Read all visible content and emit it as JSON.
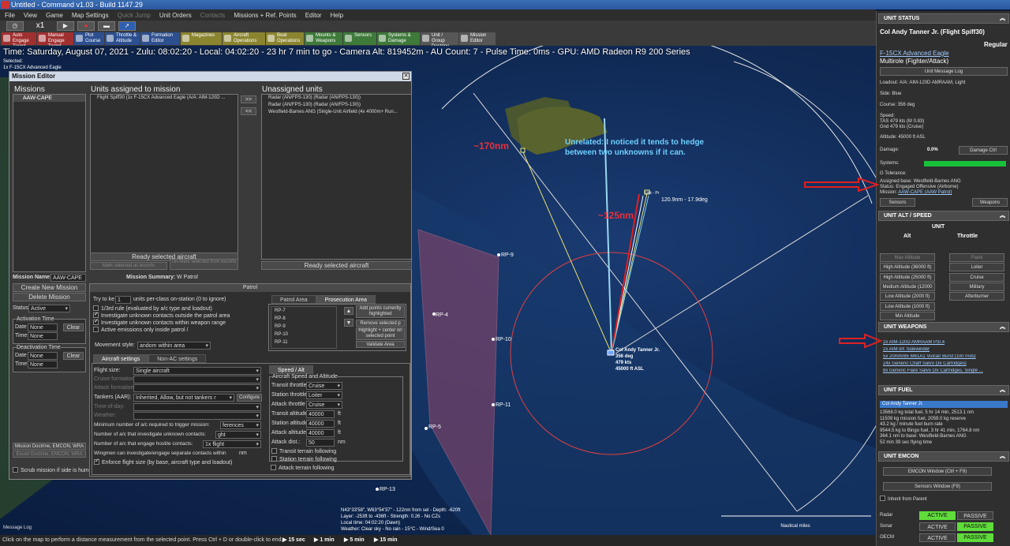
{
  "titlebar": {
    "title": "Untitled - Command v1.03 - Build 1147.29"
  },
  "menu": [
    "File",
    "View",
    "Game",
    "Map Settings",
    "Quick Jump",
    "Unit Orders",
    "Contacts",
    "Missions + Ref. Points",
    "Editor",
    "Help"
  ],
  "menu_disabled": [
    "Quick Jump",
    "Contacts"
  ],
  "toolbar": {
    "speed": "x1",
    "buttons": [
      {
        "label": "Auto Engage Target",
        "color": "red"
      },
      {
        "label": "Manual Engage Target",
        "color": "red"
      },
      {
        "label": "Plot Course",
        "color": "blue"
      },
      {
        "label": "Throttle & Altitude",
        "color": "blue"
      },
      {
        "label": "Formation Editor",
        "color": "blue"
      },
      {
        "label": "Magazines",
        "color": "yellow"
      },
      {
        "label": "Aircraft Operations",
        "color": "yellow"
      },
      {
        "label": "Boat Operations",
        "color": "yellow"
      },
      {
        "label": "Mounts & Weapons",
        "color": "green"
      },
      {
        "label": "Sensors",
        "color": "green"
      },
      {
        "label": "Systems & Damage",
        "color": "green"
      },
      {
        "label": "Unit / Group Doctrine",
        "color": "grey"
      },
      {
        "label": "Mission Editor",
        "color": "grey"
      }
    ]
  },
  "infoline": "Time: Saturday, August 07, 2021 - Zulu: 08:02:20 - Local: 04:02:20 - 23 hr 7 min to go -  Camera Alt: 819452m  - AU Count: 7 - Pulse Time: 0ms - GPU: AMD Radeon R9 200 Series",
  "selected": {
    "line1": "Selected:",
    "line2": "1x F-15CX Advanced Eagle"
  },
  "map": {
    "labels": {
      "rp4": "RP-4",
      "rp5": "RP-5",
      "rp9": "RP-9",
      "rp10": "RP-10",
      "rp11": "RP-11",
      "rp13": "RP-13",
      "bearing": "120.9nm - 17.9deg",
      "contact": "Unk - Pr"
    },
    "annotations": {
      "nm170": "~170nm",
      "nm125": "~125nm",
      "note": "Unrelated: I noticed it tends to hedge between two unknowns if it can."
    },
    "unit_label": {
      "name": "Col Andy Tanner Jr.",
      "heading": "356 deg",
      "speed": "479 kts",
      "alt": "45000 ft ASL"
    },
    "cursor": {
      "line1": "N43°33'58\", W63°54'37\" - 122nm from sel - Depth: -620ft",
      "line2": "Layer: -253ft to -436ft - Strength: 0.26 - No CZs",
      "line3": "Local time: 04:02:20 (Dawn)",
      "line4": "Weather: Clear sky - No rain - 15°C - Wind/Sea 0"
    },
    "scale_label": "Nautical miles"
  },
  "statusbar": {
    "hint": "Click on the map to perform a distance measurement from the selected point. Press Ctrl + D or double-click to end.",
    "steps": [
      "15 sec",
      "1 min",
      "5 min",
      "15 min"
    ],
    "msglog": "Message Log"
  },
  "mission_editor": {
    "title": "Mission Editor",
    "missions_header": "Missions",
    "missions": [
      "AAW-CAPE"
    ],
    "assigned_header": "Units assigned to mission",
    "assigned": [
      "Flight Spiff30 (1x F-15CX Advanced Eagle (A/A: AIM-120D ..."
    ],
    "unassigned_header": "Unassigned units",
    "unassigned": [
      "Radar (AN/FPS-130) (Radar (AN/FPS-130))",
      "Radar (AN/FPS-130) (Radar (AN/FPS-130))",
      "Westfield-Barnes ANG (Single-Unit Airfield (4x 4000m+ Run..."
    ],
    "move_right": ">>",
    "move_left": "<<",
    "ready_assigned": "Ready selected aircraft",
    "mark_escorts": "Mark selected as escorts",
    "unmark_escorts": "Un-Mark selected from escorts",
    "ready_unassigned": "Ready selected aircraft",
    "mission_name_label": "Mission Name:",
    "mission_name": "AAW-CAPE",
    "create_mission": "Create New Mission",
    "delete_mission": "Delete Mission",
    "status_label": "Status:",
    "status_value": "Active",
    "activation_label": "Activation Time",
    "deactivation_label": "Deactivation Time",
    "date_label": "Date",
    "time_label": "Time",
    "none": "None",
    "clear": "Clear",
    "msn_doctrine": "Mission Doctrine, EMCON, WRA",
    "escort_doctrine": "Escort Doctrine, EMCON, WRA",
    "scrub_label": "Scrub mission if side is human",
    "summary_label": "Mission Summary:",
    "summary_value": "W Patrol",
    "patrol_header": "Patrol",
    "try_keep_pre": "Try to ke",
    "try_keep_value": "1",
    "try_keep_post": "units per-class on-station (0 to ignore)",
    "checks": [
      {
        "label": "1/3rd rule (evaluated by a/c type and loadout)",
        "on": false
      },
      {
        "label": "Investigate unknown contacts outside the patrol area",
        "on": true
      },
      {
        "label": "Investigate unknown contacts within weapon range",
        "on": true
      },
      {
        "label": "Active emissions only inside patrol /",
        "on": false
      }
    ],
    "movement_label": "Movement style:",
    "movement_value": "andom within area",
    "area_tabs": [
      "Patrol Area",
      "Prosecution Area"
    ],
    "rp_list": [
      "RP-7",
      "RP-8",
      "RP-9",
      "RP-10",
      "RP-11"
    ],
    "add_points": "Add points currently highlighted",
    "remove_points": "Remove selected p",
    "highlight_center": "Highlight + center on selected point",
    "validate_area": "Validate Area",
    "ac_tabs": [
      "Aircraft settings",
      "Non-AC settings"
    ],
    "flight_size_label": "Flight size:",
    "flight_size_value": "Single aircraft",
    "cruise_formation": "Cruise formation",
    "attack_formation": "Attack formation",
    "tankers_label": "Tankers (AAR):",
    "tankers_value": "Inherited, Allow, but not tankers r",
    "configure": "Configure",
    "time_on_day": "Time-of-day:",
    "weather": "Weather:",
    "min_ac_label": "Minimum number of a/c required to trigger mission:",
    "min_ac_value": "ferences",
    "num_investigate_label": "Number of a/c that investigate unknown contacts:",
    "num_investigate_value": "ght",
    "num_engage_label": "Number of a/c that engage hostile contacts:",
    "num_engage_value": "1x flight",
    "wingmen_label": "Wingmen can investigate/engage separate contacts within",
    "wingmen_unit": "nm",
    "enforce_label": "Enforce flight size (by base, aircraft type and loadout)",
    "speed_tab": "Speed / Alt",
    "speed_group": "Aircraft Speed and Altitude",
    "transit_throttle": "Transit throttle",
    "transit_throttle_v": "Cruise",
    "station_throttle": "Station throttle",
    "station_throttle_v": "Loiter",
    "attack_throttle": "Attack throttle",
    "attack_throttle_v": "Cruise",
    "transit_alt": "Transit altitude",
    "station_alt": "Station altitude",
    "attack_alt": "Attack altitude",
    "alt_value": "40000",
    "alt_unit": "ft",
    "attack_dist": "Attack dist.:",
    "attack_dist_v": "50",
    "dist_unit": "nm",
    "terrain_checks": [
      "Transit terrain following",
      "Station terrain following",
      "Attack terrain following"
    ]
  },
  "unit_status": {
    "header": "UNIT STATUS",
    "name": "Col Andy Tanner Jr. (Flight Spiff30)",
    "proficiency": "Regular",
    "type": "F-15CX Advanced Eagle",
    "role": "Multirole (Fighter/Attack)",
    "msg_log": "Unit Message Log",
    "loadout": "Loadout: A/A: AIM-120D AMRAAM, Light",
    "side": "Side: Blue",
    "course": "Course: 356 deg",
    "speed_label": "Speed:",
    "tas": "TAS 479 kts (M 0.83)",
    "gnd": "Gnd 479 kts (Cruise)",
    "altitude": "Altitude: 45000 ft ASL",
    "damage_label": "Damage:",
    "damage_value": "0.0%",
    "damage_ctrl": "Damage Ctrl",
    "systems": "Systems:",
    "systems_health": 100,
    "g_tol": "G Tolerance:",
    "base": "Assigned base: Westfield-Barnes ANG",
    "status": "Status: Engaged Offensive (Airborne)",
    "mission_label": "Mission:",
    "mission": "AAW-CAPE (AAW Patrol)",
    "sensors": "Sensors",
    "weapons": "Weapons"
  },
  "alt_speed": {
    "header": "UNIT ALT / SPEED",
    "unit": "UNIT",
    "alt": "Alt",
    "throttle": "Throttle",
    "alt_buttons": [
      "Max Altitude",
      "High Altitude (36000 ft)",
      "High Altitude (25000 ft)",
      "Medium Altitude (12000",
      "Low Altitude (2000 ft)",
      "Low Altitude (1000 ft)",
      "Min Altitude"
    ],
    "throttle_buttons": [
      "Flank",
      "Loiter",
      "Cruise",
      "Military",
      "Afterburner"
    ]
  },
  "weapons": {
    "header": "UNIT WEAPONS",
    "items": [
      "2x AIM-120D AMRAAM P3I.4",
      "2x AIM-9X Sidewinder",
      "5x 20mm/85 M61A1 Vulcan Burst [100 rnds]",
      "24x Generic Chaff Salvo [3x Cartridges]",
      "8x Generic Flare Salvo [3x Cartridges, Single ..."
    ]
  },
  "fuel": {
    "header": "UNIT FUEL",
    "selected": "Col Andy Tanner Jr.",
    "lines": [
      "13568.0 kg total fuel, 5 hr 14 min, 2513.1 nm",
      "11509 kg mission fuel, 2059.0 kg reserve",
      "43.2 kg / minute fuel burn rate",
      "9544.5 kg to Bingo fuel, 3 hr 41 min, 1764.8 nm",
      "364.1 nm to base: Westfield-Barnes ANG",
      "52 min 39 sec flying time"
    ]
  },
  "emcon": {
    "header": "UNIT EMCON",
    "emcon_window": "EMCON Window (Ctrl + F9)",
    "sensors_window": "Sensors Window (F9)",
    "inherit": "Inherit from Parent",
    "rows": [
      {
        "name": "Radar",
        "active": "ACTIVE",
        "passive": "PASSIVE"
      },
      {
        "name": "Sonar",
        "active": "ACTIVE",
        "passive": "PASSIVE"
      },
      {
        "name": "OECM",
        "active": "ACTIVE",
        "passive": "PASSIVE"
      }
    ]
  }
}
